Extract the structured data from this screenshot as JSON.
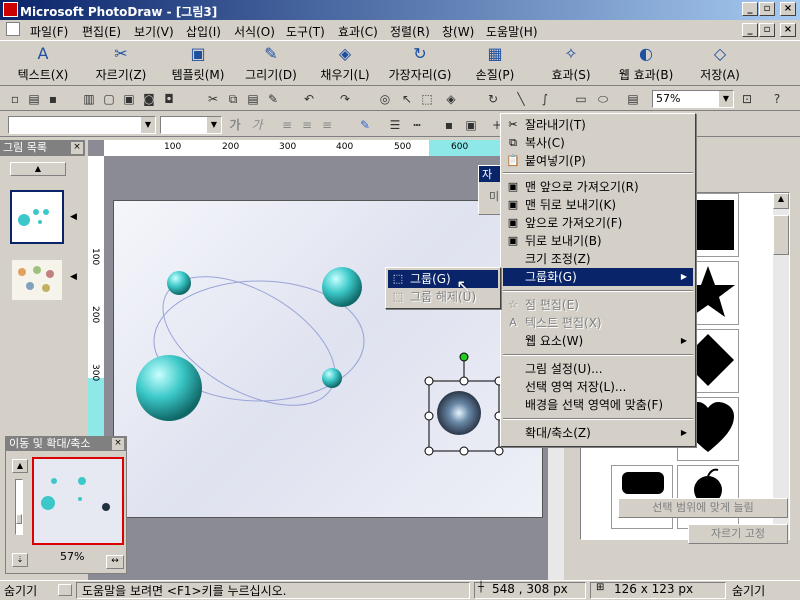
{
  "window": {
    "title": "Microsoft PhotoDraw - [그림3]",
    "min": "_",
    "max": "▫",
    "close": "×"
  },
  "menubar": [
    "파일(F)",
    "편집(E)",
    "보기(V)",
    "삽입(I)",
    "서식(O)",
    "도구(T)",
    "효과(C)",
    "정렬(R)",
    "창(W)",
    "도움말(H)"
  ],
  "bigbar": [
    {
      "label": "텍스트(X)",
      "icon": "A"
    },
    {
      "label": "자르기(Z)",
      "icon": "✂"
    },
    {
      "label": "템플릿(M)",
      "icon": "▣"
    },
    {
      "label": "그리기(D)",
      "icon": "✎"
    },
    {
      "label": "채우기(L)",
      "icon": "◈"
    },
    {
      "label": "가장자리(G)",
      "icon": "↻"
    },
    {
      "label": "손질(P)",
      "icon": "▦"
    },
    {
      "label": "효과(S)",
      "icon": "✧"
    },
    {
      "label": "웹 효과(B)",
      "icon": "◐"
    },
    {
      "label": "저장(A)",
      "icon": "◇"
    }
  ],
  "stdbar": {
    "zoom": "57%"
  },
  "fmtbar": {
    "bold": "가",
    "italic": "가"
  },
  "left_panel": {
    "title": "그림 목록"
  },
  "navigator": {
    "title": "이동 및 확대/축소",
    "zoom": "57%"
  },
  "ruler": {
    "top_ticks": [
      "100",
      "200",
      "300",
      "400",
      "500",
      "600"
    ],
    "left_ticks": [
      "100",
      "200",
      "300"
    ]
  },
  "mini_dialog": {
    "title_a": "자",
    "body_a": "미"
  },
  "context_menu": {
    "items": [
      {
        "label": "잘라내기(T)",
        "icon": "✂",
        "state": "normal"
      },
      {
        "label": "복사(C)",
        "icon": "⧉",
        "state": "normal"
      },
      {
        "label": "붙여넣기(P)",
        "icon": "📋",
        "state": "normal"
      },
      {
        "label": "맨 앞으로 가져오기(R)",
        "icon": "▣",
        "state": "normal"
      },
      {
        "label": "맨 뒤로 보내기(K)",
        "icon": "▣",
        "state": "normal"
      },
      {
        "label": "앞으로 가져오기(F)",
        "icon": "▣",
        "state": "normal"
      },
      {
        "label": "뒤로 보내기(B)",
        "icon": "▣",
        "state": "normal"
      },
      {
        "label": "크기 조정(Z)",
        "icon": "",
        "state": "normal"
      },
      {
        "label": "그룹화(G)",
        "icon": "",
        "state": "highlighted",
        "submenu": true
      },
      {
        "label": "점 편집(E)",
        "icon": "☆",
        "state": "disabled"
      },
      {
        "label": "텍스트 편집(X)",
        "icon": "A",
        "state": "disabled"
      },
      {
        "label": "웹 요소(W)",
        "icon": "",
        "state": "normal",
        "submenu": true
      },
      {
        "label": "그림 설정(U)...",
        "icon": "",
        "state": "normal"
      },
      {
        "label": "선택 영역 저장(L)...",
        "icon": "",
        "state": "normal"
      },
      {
        "label": "배경을 선택 영역에 맞춤(F)",
        "icon": "",
        "state": "normal"
      },
      {
        "label": "확대/축소(Z)",
        "icon": "",
        "state": "normal",
        "submenu": true
      }
    ]
  },
  "submenu": {
    "items": [
      {
        "label": "그룹(G)",
        "state": "highlighted"
      },
      {
        "label": "그룹 해제(U)",
        "state": "disabled"
      }
    ]
  },
  "right_panel": {
    "fit_button": "선택 범위에 맞게 늘림",
    "crop_button": "자르기 고정"
  },
  "statusbar": {
    "hide_left": "숨기기",
    "help": "도움말을 보려면 <F1>키를 누르십시오.",
    "coords": "548 , 308 px",
    "size": "126 x 123 px",
    "hide_right": "숨기기"
  },
  "colors": {
    "title_start": "#0a246a",
    "title_end": "#a6caf0",
    "highlight": "#0a246a",
    "sphere": "#3cc8c8"
  }
}
